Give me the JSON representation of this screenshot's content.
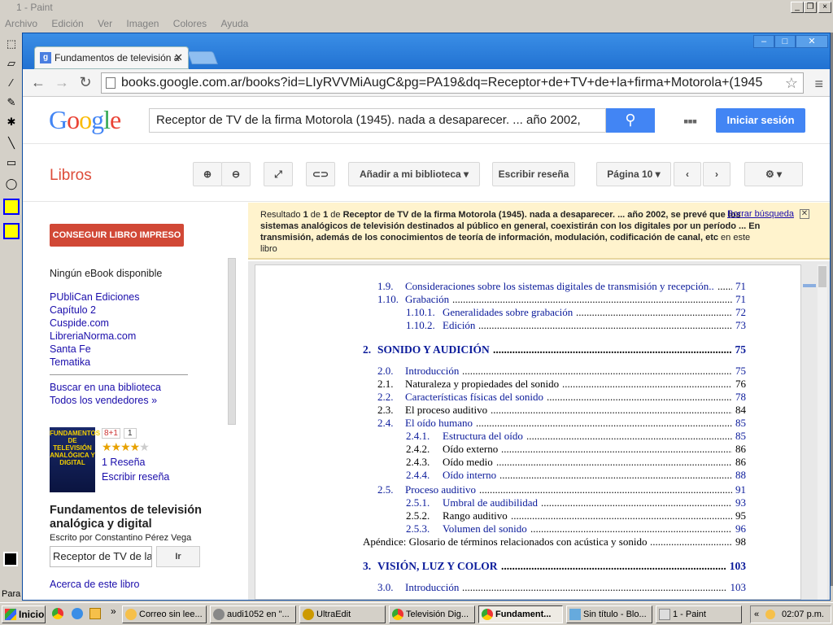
{
  "paint": {
    "title": "1 - Paint",
    "menu": [
      "Archivo",
      "Edición",
      "Ver",
      "Imagen",
      "Colores",
      "Ayuda"
    ],
    "status": "Para"
  },
  "chrome": {
    "tab_title": "Fundamentos de televisión a",
    "url": "books.google.com.ar/books?id=LIyRVVMiAugC&pg=PA19&dq=Receptor+de+TV+de+la+firma+Motorola+(1945"
  },
  "google": {
    "logo": "Google",
    "search_value": "Receptor de TV de la firma Motorola (1945). nada a desaparecer. ... año 2002,",
    "signin": "Iniciar sesión",
    "libros": "Libros",
    "toolbar": {
      "add_library": "Añadir a mi biblioteca",
      "write_review": "Escribir reseña",
      "page": "Página 10"
    }
  },
  "left": {
    "buy": "CONSEGUIR LIBRO IMPRESO",
    "no_ebook": "Ningún eBook disponible",
    "sellers": [
      "PUbliCan Ediciones",
      "Capítulo 2",
      "Cuspide.com",
      "LibreriaNorma.com",
      "Santa Fe",
      "Tematika"
    ],
    "find_library": "Buscar en una biblioteca",
    "all_sellers": "Todos los vendedores »",
    "cover_text": "FUNDAMENTOS DE TELEVISIÓN ANALÓGICA Y DIGITAL",
    "gplus": "8+1",
    "gcount": "1",
    "rating": 4,
    "reviews": "1 Reseña",
    "write_review": "Escribir reseña",
    "book_title": "Fundamentos de televisión analógica y digital",
    "author": "Escrito por Constantino Pérez Vega",
    "in_search": "Receptor de TV de la",
    "go": "Ir",
    "about": "Acerca de este libro"
  },
  "banner": {
    "result": "Resultado",
    "one": "1",
    "of": "de",
    "total": "1",
    "connector": "de",
    "query": "Receptor de TV de la firma Motorola (1945). nada a desaparecer. ... año 2002, se prevé que los sistemas analógicos de televisión destinados al público en general, coexistirán con los digitales por un período ... En transmisión, además de los conocimientos de teoría de información, modulación, codificación de canal, etc",
    "suffix": "en este libro",
    "clear": "Borrar búsqueda"
  },
  "toc": [
    {
      "num": "1.9.",
      "text": "Consideraciones sobre los sistemas digitales de transmisión y recepción..",
      "page": "71",
      "indent": 1,
      "link": true
    },
    {
      "num": "1.10.",
      "text": "Grabación",
      "page": "71",
      "indent": 1,
      "link": true
    },
    {
      "num": "1.10.1.",
      "text": "Generalidades sobre grabación",
      "page": "72",
      "indent": 2,
      "link": true
    },
    {
      "num": "1.10.2.",
      "text": "Edición",
      "page": "73",
      "indent": 2,
      "link": true
    },
    {
      "num": "2.",
      "text": "SONIDO Y AUDICIÓN",
      "page": "75",
      "indent": 0,
      "link": true,
      "chapter": true
    },
    {
      "num": "2.0.",
      "text": "Introducción",
      "page": "75",
      "indent": 1,
      "link": true
    },
    {
      "num": "2.1.",
      "text": "Naturaleza y propiedades del sonido",
      "page": "76",
      "indent": 1,
      "link": false
    },
    {
      "num": "2.2.",
      "text": "Características físicas del sonido",
      "page": "78",
      "indent": 1,
      "link": true
    },
    {
      "num": "2.3.",
      "text": "El proceso auditivo",
      "page": "84",
      "indent": 1,
      "link": false
    },
    {
      "num": "2.4.",
      "text": "El oído humano",
      "page": "85",
      "indent": 1,
      "link": true
    },
    {
      "num": "2.4.1.",
      "text": "Estructura del oído",
      "page": "85",
      "indent": 2,
      "link": true
    },
    {
      "num": "2.4.2.",
      "text": "Oído externo",
      "page": "86",
      "indent": 2,
      "link": false
    },
    {
      "num": "2.4.3.",
      "text": "Oído medio",
      "page": "86",
      "indent": 2,
      "link": false
    },
    {
      "num": "2.4.4.",
      "text": "Oído interno",
      "page": "88",
      "indent": 2,
      "link": true
    },
    {
      "num": "2.5.",
      "text": "Proceso auditivo",
      "page": "91",
      "indent": 1,
      "link": true
    },
    {
      "num": "2.5.1.",
      "text": "Umbral de audibilidad",
      "page": "93",
      "indent": 2,
      "link": true
    },
    {
      "num": "2.5.2.",
      "text": "Rango auditivo",
      "page": "95",
      "indent": 2,
      "link": false
    },
    {
      "num": "2.5.3.",
      "text": "Volumen del sonido",
      "page": "96",
      "indent": 2,
      "link": true
    },
    {
      "num": "",
      "text": "Apéndice: Glosario de términos relacionados con acústica y sonido",
      "page": "98",
      "indent": -1,
      "link": false
    },
    {
      "num": "3.",
      "text": "VISIÓN, LUZ Y COLOR",
      "page": "103",
      "indent": 0,
      "link": true,
      "chapter": true
    },
    {
      "num": "3.0.",
      "text": "Introducción",
      "page": "103",
      "indent": 1,
      "link": true
    }
  ],
  "taskbar": {
    "start": "Inicio",
    "tasks": [
      "Correo sin lee...",
      "audi1052 en \"...",
      "UltraEdit",
      "Televisión Dig...",
      "Fundament...",
      "Sin título - Blo...",
      "1 - Paint"
    ],
    "clock": "02:07 p.m."
  }
}
